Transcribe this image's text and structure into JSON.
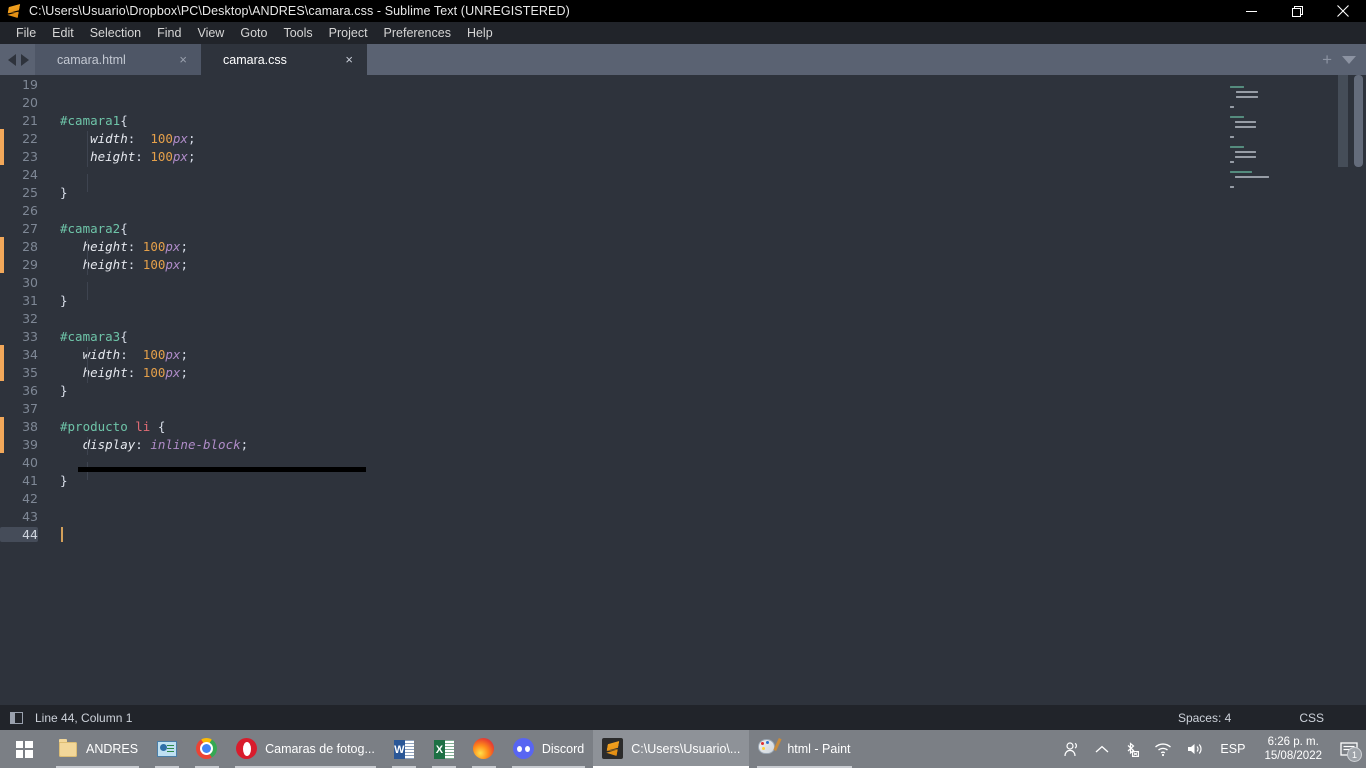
{
  "window": {
    "title": "C:\\Users\\Usuario\\Dropbox\\PC\\Desktop\\ANDRES\\camara.css - Sublime Text (UNREGISTERED)",
    "icon": "sublime-text-icon",
    "controls": {
      "minimize": "minimize-icon",
      "maximize": "restore-icon",
      "close": "close-icon"
    }
  },
  "menubar": {
    "items": [
      {
        "label": "File"
      },
      {
        "label": "Edit"
      },
      {
        "label": "Selection"
      },
      {
        "label": "Find"
      },
      {
        "label": "View"
      },
      {
        "label": "Goto"
      },
      {
        "label": "Tools"
      },
      {
        "label": "Project"
      },
      {
        "label": "Preferences"
      },
      {
        "label": "Help"
      }
    ]
  },
  "tabbar": {
    "nav_prev": "chevron-left-icon",
    "nav_next": "chevron-right-icon",
    "close_glyph": "×",
    "new_tab_glyph": "+",
    "tabs": [
      {
        "label": "camara.html",
        "active": false
      },
      {
        "label": "camara.css",
        "active": true
      }
    ]
  },
  "editor": {
    "first_line": 19,
    "lines": [
      {
        "n": 19,
        "text": "",
        "modified": false
      },
      {
        "n": 20,
        "text": "",
        "modified": false
      },
      {
        "n": 21,
        "text": "#camara1{",
        "modified": false
      },
      {
        "n": 22,
        "text": "    width:  100px;",
        "modified": true
      },
      {
        "n": 23,
        "text": "    height: 100px;",
        "modified": true
      },
      {
        "n": 24,
        "text": "",
        "modified": false
      },
      {
        "n": 25,
        "text": "}",
        "modified": false
      },
      {
        "n": 26,
        "text": "",
        "modified": false
      },
      {
        "n": 27,
        "text": "#camara2{",
        "modified": false
      },
      {
        "n": 28,
        "text": "   height: 100px;",
        "modified": true
      },
      {
        "n": 29,
        "text": "   height: 100px;",
        "modified": true
      },
      {
        "n": 30,
        "text": "",
        "modified": false
      },
      {
        "n": 31,
        "text": "}",
        "modified": false
      },
      {
        "n": 32,
        "text": "",
        "modified": false
      },
      {
        "n": 33,
        "text": "#camara3{",
        "modified": false
      },
      {
        "n": 34,
        "text": "   width:  100px;",
        "modified": true
      },
      {
        "n": 35,
        "text": "   height: 100px;",
        "modified": true
      },
      {
        "n": 36,
        "text": "}",
        "modified": false
      },
      {
        "n": 37,
        "text": "",
        "modified": false
      },
      {
        "n": 38,
        "text": "#producto li {",
        "modified": true
      },
      {
        "n": 39,
        "text": "   display: inline-block;",
        "modified": true
      },
      {
        "n": 40,
        "text": "",
        "modified": false
      },
      {
        "n": 41,
        "text": "}",
        "modified": false
      },
      {
        "n": 42,
        "text": "",
        "modified": false
      },
      {
        "n": 43,
        "text": "",
        "modified": false
      },
      {
        "n": 44,
        "text": "",
        "modified": false
      }
    ],
    "cursor_line": 44,
    "colors": {
      "background": "#2e333c",
      "selector": "#6ec4a8",
      "tag": "#e06c75",
      "number": "#e5a04a",
      "unit": "#b08cc9",
      "text": "#d8dee9",
      "gutter_text": "#7f8896",
      "modified_marker": "#f2a85a",
      "caret": "#d3a05a"
    }
  },
  "statusbar": {
    "sidebar_icon": "sidebar-toggle-icon",
    "position": "Line 44, Column 1",
    "indentation": "Spaces: 4",
    "syntax": "CSS"
  },
  "taskbar": {
    "start": "windows-start-icon",
    "items": [
      {
        "label": "ANDRES",
        "icon": "folder-icon",
        "state": "pinned-open",
        "show_label": true
      },
      {
        "label": "",
        "icon": "blue-app-icon",
        "state": "pinned",
        "show_label": false
      },
      {
        "label": "",
        "icon": "chrome-icon",
        "state": "pinned",
        "show_label": false
      },
      {
        "label": "Camaras de fotog...",
        "icon": "opera-icon",
        "state": "open",
        "show_label": true
      },
      {
        "label": "",
        "icon": "word-icon",
        "state": "pinned",
        "show_label": false
      },
      {
        "label": "",
        "icon": "excel-icon",
        "state": "pinned",
        "show_label": false
      },
      {
        "label": "",
        "icon": "firefox-icon",
        "state": "pinned",
        "show_label": false
      },
      {
        "label": "Discord",
        "icon": "discord-icon",
        "state": "open",
        "show_label": true
      },
      {
        "label": "C:\\Users\\Usuario\\...",
        "icon": "sublime-text-icon",
        "state": "active",
        "show_label": true
      },
      {
        "label": "html - Paint",
        "icon": "paint-icon",
        "state": "open",
        "show_label": true
      }
    ],
    "tray": {
      "people_icon": "people-icon",
      "chevron_icon": "show-hidden-icons-chevron",
      "bluetooth_icon": "bluetooth-disabled-icon",
      "network_icon": "wifi-icon",
      "volume_icon": "volume-icon",
      "language": "ESP",
      "time": "6:26 p. m.",
      "date": "15/08/2022",
      "notifications_icon": "action-center-icon",
      "notifications_count": "1"
    }
  }
}
